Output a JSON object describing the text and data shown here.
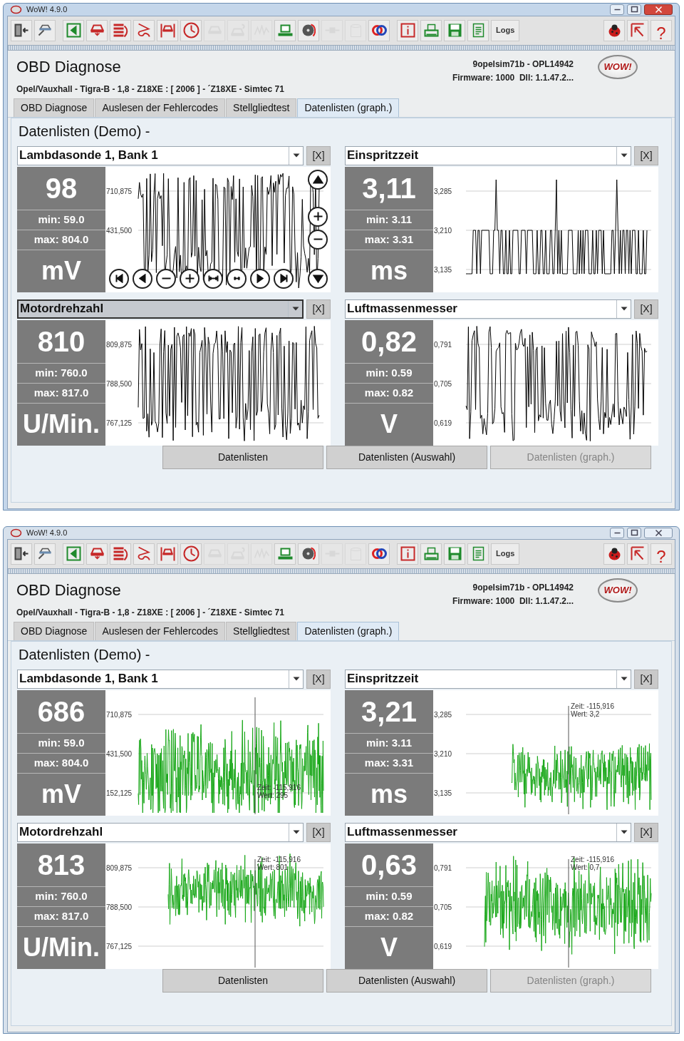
{
  "windows": [
    {
      "title": "WoW! 4.9.0",
      "active": true,
      "toolbar": {
        "left": [
          [
            {
              "kind": "exit",
              "disabled": false
            },
            {
              "kind": "car-tool",
              "disabled": false
            }
          ],
          [
            {
              "kind": "back",
              "disabled": false
            },
            {
              "kind": "car-down",
              "disabled": false
            },
            {
              "kind": "list",
              "disabled": false
            },
            {
              "kind": "curve",
              "disabled": false
            },
            {
              "kind": "lift",
              "disabled": false
            },
            {
              "kind": "clock",
              "disabled": false
            },
            {
              "kind": "car",
              "disabled": true
            },
            {
              "kind": "car-question",
              "disabled": true
            },
            {
              "kind": "graph",
              "disabled": true
            },
            {
              "kind": "laptop",
              "disabled": false
            },
            {
              "kind": "disc",
              "disabled": false
            },
            {
              "kind": "plug",
              "disabled": true
            },
            {
              "kind": "cylinder",
              "disabled": true
            },
            {
              "kind": "sync",
              "disabled": false
            }
          ],
          [
            {
              "kind": "info",
              "disabled": false
            },
            {
              "kind": "printer",
              "disabled": false
            },
            {
              "kind": "floppy",
              "disabled": false
            },
            {
              "kind": "document",
              "disabled": false
            },
            {
              "kind": "text",
              "label": "Logs",
              "disabled": false
            }
          ]
        ],
        "right": [
          {
            "kind": "bug",
            "disabled": false
          },
          {
            "kind": "pointer",
            "disabled": false
          },
          {
            "kind": "text",
            "label": "?",
            "disabled": false
          }
        ]
      },
      "header": {
        "title": "OBD Diagnose",
        "vehicle": "Opel/Vauxhall - Tigra-B - 1,8 - Z18XE : [ 2006 ] - ´Z18XE - Simtec 71",
        "device": "9opelsim71b - OPL14942",
        "firmware": "Firmware: 1000  Dll: 1.1.47.2...",
        "logo": "WOW!"
      },
      "tabs": [
        {
          "label": "OBD Diagnose",
          "selected": false
        },
        {
          "label": "Auslesen der Fehlercodes",
          "selected": false
        },
        {
          "label": "Stellgliedtest",
          "selected": false
        },
        {
          "label": "Datenlisten (graph.)",
          "selected": true
        }
      ],
      "section_title": "Datenlisten (Demo) -",
      "panels": [
        {
          "name": "Lambdasonde 1, Bank 1",
          "focused": false,
          "close_label": "[X]",
          "value": "98",
          "min": "min: 59.0",
          "max": "max: 804.0",
          "unit": "mV",
          "ticks": [
            "710,875",
            "431,500"
          ],
          "color": "#000000",
          "nav_controls": true
        },
        {
          "name": "Einspritzzeit",
          "focused": false,
          "close_label": "[X]",
          "value": "3,11",
          "min": "min: 3.11",
          "max": "max: 3.31",
          "unit": "ms",
          "ticks": [
            "3,285",
            "3,210",
            "3,135"
          ],
          "color": "#000000",
          "nav_controls": false
        },
        {
          "name": "Motordrehzahl",
          "focused": true,
          "close_label": "[X]",
          "value": "810",
          "min": "min: 760.0",
          "max": "max: 817.0",
          "unit": "U/Min.",
          "ticks": [
            "809,875",
            "788,500",
            "767,125"
          ],
          "color": "#000000",
          "nav_controls": false
        },
        {
          "name": "Luftmassenmesser",
          "focused": false,
          "close_label": "[X]",
          "value": "0,82",
          "min": "min: 0.59",
          "max": "max: 0.82",
          "unit": "V",
          "ticks": [
            "0,791",
            "0,705",
            "0,619"
          ],
          "color": "#000000",
          "nav_controls": false
        }
      ],
      "buttons": [
        {
          "label": "Datenlisten",
          "disabled": false
        },
        {
          "label": "Datenlisten (Auswahl)",
          "disabled": false
        },
        {
          "label": "Datenlisten (graph.)",
          "disabled": true
        }
      ]
    },
    {
      "title": "WoW! 4.9.0",
      "active": false,
      "toolbar": {
        "left": [
          [
            {
              "kind": "exit",
              "disabled": false
            },
            {
              "kind": "car-tool",
              "disabled": false
            }
          ],
          [
            {
              "kind": "back",
              "disabled": false
            },
            {
              "kind": "car-down",
              "disabled": false
            },
            {
              "kind": "list",
              "disabled": false
            },
            {
              "kind": "curve",
              "disabled": false
            },
            {
              "kind": "lift",
              "disabled": false
            },
            {
              "kind": "clock",
              "disabled": false
            },
            {
              "kind": "car",
              "disabled": true
            },
            {
              "kind": "car-question",
              "disabled": true
            },
            {
              "kind": "graph",
              "disabled": true
            },
            {
              "kind": "laptop",
              "disabled": false
            },
            {
              "kind": "disc",
              "disabled": false
            },
            {
              "kind": "plug",
              "disabled": true
            },
            {
              "kind": "cylinder",
              "disabled": true
            },
            {
              "kind": "sync",
              "disabled": false
            }
          ],
          [
            {
              "kind": "info",
              "disabled": false
            },
            {
              "kind": "printer",
              "disabled": false
            },
            {
              "kind": "floppy",
              "disabled": false
            },
            {
              "kind": "document",
              "disabled": false
            },
            {
              "kind": "text",
              "label": "Logs",
              "disabled": false
            }
          ]
        ],
        "right": [
          {
            "kind": "bug",
            "disabled": false
          },
          {
            "kind": "pointer",
            "disabled": false
          },
          {
            "kind": "text",
            "label": "?",
            "disabled": false
          }
        ]
      },
      "header": {
        "title": "OBD Diagnose",
        "vehicle": "Opel/Vauxhall - Tigra-B - 1,8 - Z18XE : [ 2006 ] - ´Z18XE - Simtec 71",
        "device": "9opelsim71b - OPL14942",
        "firmware": "Firmware: 1000  Dll: 1.1.47.2...",
        "logo": "WOW!"
      },
      "tabs": [
        {
          "label": "OBD Diagnose",
          "selected": false
        },
        {
          "label": "Auslesen der Fehlercodes",
          "selected": false
        },
        {
          "label": "Stellgliedtest",
          "selected": false
        },
        {
          "label": "Datenlisten (graph.)",
          "selected": true
        }
      ],
      "section_title": "Datenlisten (Demo) -",
      "panels": [
        {
          "name": "Lambdasonde 1, Bank 1",
          "focused": false,
          "close_label": "[X]",
          "value": "686",
          "min": "min: 59.0",
          "max": "max: 804.0",
          "unit": "mV",
          "ticks": [
            "710,875",
            "431,500",
            "152,125"
          ],
          "color": "#1aa81a",
          "cursor": {
            "time": "Zeit: -115,916",
            "value": "Wert: 295"
          }
        },
        {
          "name": "Einspritzzeit",
          "focused": false,
          "close_label": "[X]",
          "value": "3,21",
          "min": "min: 3.11",
          "max": "max: 3.31",
          "unit": "ms",
          "ticks": [
            "3,285",
            "3,210",
            "3,135"
          ],
          "color": "#1aa81a",
          "cursor": {
            "time": "Zeit: -115,916",
            "value": "Wert: 3,2"
          }
        },
        {
          "name": "Motordrehzahl",
          "focused": false,
          "close_label": "[X]",
          "value": "813",
          "min": "min: 760.0",
          "max": "max: 817.0",
          "unit": "U/Min.",
          "ticks": [
            "809,875",
            "788,500",
            "767,125"
          ],
          "color": "#1aa81a",
          "cursor": {
            "time": "Zeit: -115,916",
            "value": "Wert: 801"
          }
        },
        {
          "name": "Luftmassenmesser",
          "focused": false,
          "close_label": "[X]",
          "value": "0,63",
          "min": "min: 0.59",
          "max": "max: 0.82",
          "unit": "V",
          "ticks": [
            "0,791",
            "0,705",
            "0,619"
          ],
          "color": "#1aa81a",
          "cursor": {
            "time": "Zeit: -115,916",
            "value": "Wert: 0,7"
          }
        }
      ],
      "buttons": [
        {
          "label": "Datenlisten",
          "disabled": false
        },
        {
          "label": "Datenlisten (Auswahl)",
          "disabled": false
        },
        {
          "label": "Datenlisten (graph.)",
          "disabled": true
        }
      ]
    }
  ]
}
